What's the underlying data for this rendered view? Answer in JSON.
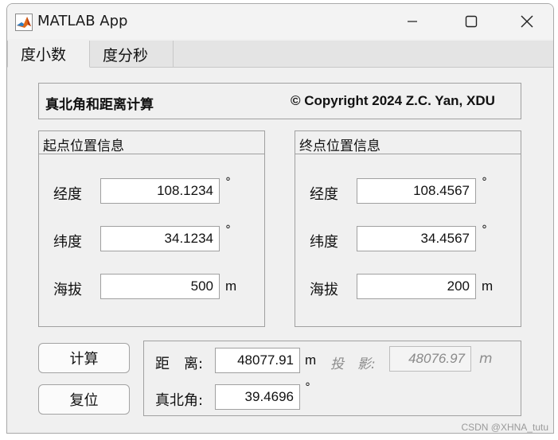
{
  "window": {
    "title": "MATLAB App"
  },
  "tabs": [
    {
      "label": "度小数"
    },
    {
      "label": "度分秒"
    }
  ],
  "header": {
    "title": "真北角和距离计算",
    "copyright": "© Copyright 2024 Z.C. Yan, XDU"
  },
  "start_panel": {
    "title": "起点位置信息",
    "longitude": {
      "label": "经度",
      "value": "108.1234",
      "unit": "°"
    },
    "latitude": {
      "label": "纬度",
      "value": "34.1234",
      "unit": "°"
    },
    "altitude": {
      "label": "海拔",
      "value": "500",
      "unit": "m"
    }
  },
  "end_panel": {
    "title": "终点位置信息",
    "longitude": {
      "label": "经度",
      "value": "108.4567",
      "unit": "°"
    },
    "latitude": {
      "label": "纬度",
      "value": "34.4567",
      "unit": "°"
    },
    "altitude": {
      "label": "海拔",
      "value": "200",
      "unit": "m"
    }
  },
  "buttons": {
    "compute": "计算",
    "reset": "复位"
  },
  "results": {
    "distance": {
      "label": "距　离:",
      "value": "48077.91",
      "unit": "m"
    },
    "projection": {
      "label": "投　影:",
      "value": "48076.97",
      "unit": "m"
    },
    "true_north": {
      "label": "真北角:",
      "value": "39.4696",
      "unit": "°"
    }
  },
  "watermark": "CSDN @XHNA_tutu",
  "icons": {
    "app": "matlab-icon",
    "minimize": "minimize-icon",
    "maximize": "maximize-icon",
    "close": "close-icon"
  }
}
